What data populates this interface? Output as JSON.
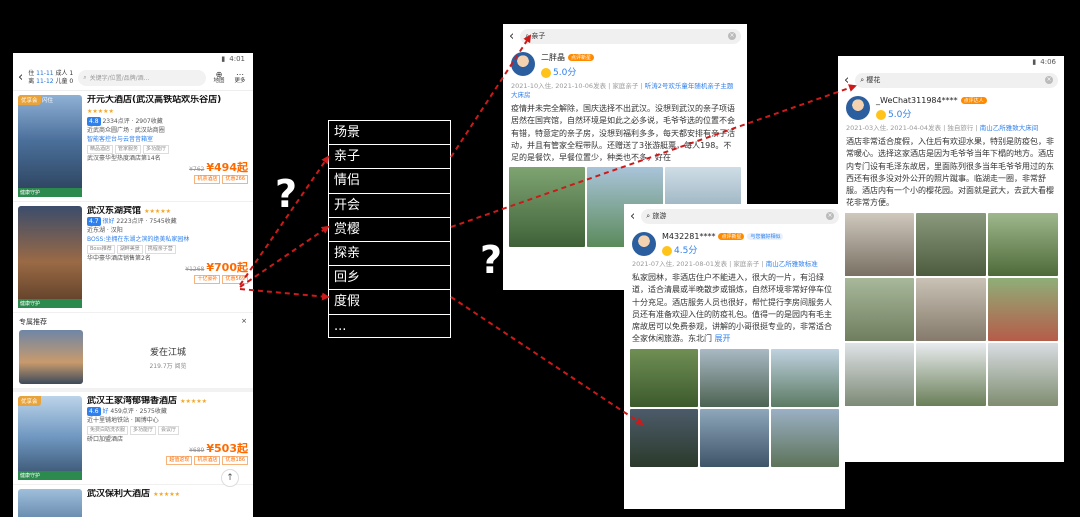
{
  "colors": {
    "arrow": "#cc1a1a",
    "accent": "#2f80ed",
    "price": "#ff6a00"
  },
  "hotel_list": {
    "status": "4:01",
    "header": {
      "in_label": "住",
      "in_date": "11-11",
      "out_label": "离",
      "out_date": "11-12",
      "adults": "成人 1",
      "children": "儿童 0",
      "search_placeholder": "关键字/位置/品牌/酒...",
      "map_label": "地图",
      "more_label": "更多"
    },
    "hotels": [
      {
        "tag": "优享会",
        "tag2": "闪住",
        "name": "开元大酒店(武汉高铁站欢乐谷店)",
        "stars": "★★★★★",
        "score": "4.8",
        "reviews": "2334点评 · 2907收藏",
        "location": "近武商众圆广场 · 武汉站商圈",
        "features": "智能客控台与云音音箱室",
        "tags": [
          "精品酒店",
          "管家服务",
          "多功能厅"
        ],
        "note": "武汉豪华型热度酒店第14名",
        "old_price": "¥762",
        "price": "¥494起",
        "promo_tags": [
          "机票酒店",
          "优惠266"
        ],
        "foot": "健康守护"
      },
      {
        "tag": "",
        "tag2": "",
        "name": "武汉东湖宾馆",
        "stars": "★★★★★",
        "score": "4.7",
        "score_word": "很好",
        "reviews": "2223点评 · 7545收藏",
        "location": "近东湖 · 汉阳",
        "boss": "BOSS:坐拥在东湖之滨的绝美私家园林",
        "tags": [
          "Boss推荐",
          "湖畔美景",
          "携程亲子营"
        ],
        "note": "华中豪华酒店销售第2名",
        "old_price": "¥1268",
        "price": "¥700起",
        "promo_tags": [
          "十亿豪补",
          "优惠569"
        ],
        "foot": "健康守护"
      },
      {
        "tag": "优享会",
        "tag2": "",
        "name": "武汉王家湾郁锦香酒店",
        "stars": "★★★★★",
        "score": "4.6",
        "score_word": "好",
        "reviews": "459点评 · 2575收藏",
        "location": "近十里铺地铁站 · 国博中心",
        "boss": "免费白助洗衣服",
        "tags": [
          "多功能厅",
          "会议厅"
        ],
        "note": "硚口加盟酒店",
        "old_price": "¥689",
        "price": "¥503起",
        "promo_tags": [
          "超值返现",
          "机票酒店",
          "优惠186"
        ],
        "foot": "健康守护"
      },
      {
        "tag": "",
        "tag2": "",
        "name": "武汉保利大酒店",
        "stars": "★★★★★",
        "score": "",
        "reviews": "",
        "location": "",
        "tags": [],
        "note": "",
        "old_price": "",
        "price": "",
        "promo_tags": [],
        "foot": ""
      }
    ],
    "promo": {
      "title": "专属推荐",
      "close": "×",
      "text": "爱在江城",
      "sub": "219.7万 阅览"
    }
  },
  "menu": [
    "场景",
    "亲子",
    "情侣",
    "开会",
    "赏樱",
    "探亲",
    "回乡",
    "度假",
    "..."
  ],
  "question_marks": [
    "?",
    "?"
  ],
  "review_qinzi": {
    "search": "亲子",
    "user": "二胖晶",
    "badge": "点评新星",
    "score": "5.0分",
    "meta1": "2021-10入住, 2021-10-06发表",
    "meta_type": "家庭亲子",
    "room": "听涛2号欢乐童年随机亲子主题大床房",
    "text": "疫情并未完全解除，国庆选择不出武汉。没想到武汉的亲子项语居然在国宾馆，自然环境是如此之必多说，毛爷爷选的位置不会有错，特意定的亲子房，没想到福利多多，每天都安排有亲子活动，并且有管家全程带队。还赠送了3张游艇票，每人198。不足的是餐饮，早餐位置少，种类也不多，好在"
  },
  "review_lvyou": {
    "search": "旅游",
    "user": "M432281****",
    "badge": "点评新星",
    "badge2": "与您偏好相似",
    "score": "4.5分",
    "meta1": "2021-07入住, 2021-08-01发表",
    "meta_type": "家庭亲子",
    "room": "南山乙所雅致标准",
    "text": "私家园林，非酒店住户不能进入，很大的一片，有沿绿道，适合清晨或半晚散步或锻炼，自然环境非常好停车位十分充足。酒店服务人员也很好，帮忙提行李房间服务人员还有准备欢迎入住的防疫礼包。值得一的是园内有毛主席故居可以免费参观，讲解的小哥很挺专业的，非常适合全家休闲旅游。东北门",
    "more": "展开"
  },
  "review_yinghua": {
    "status": "4:06",
    "search": "樱花",
    "user": "_WeChat311984****",
    "badge": "点评达人",
    "score": "5.0分",
    "meta1": "2021-03入住, 2021-04-04发表",
    "meta_type": "独自旅行",
    "room": "南山乙所雅致大床间",
    "text": "酒店非常适合度假，入住后有欢迎水果，特别是防疫包，非常暖心。选择这家酒店是因为毛爷爷当年下榻的地方。酒店内专门设有毛泽东故居，里面陈列很多当年毛爷爷用过的东西还有很多没对外公开的照片蹴事。临湖走一圈，非常舒服。酒店内有一个小的樱花园。对面就是武大，去武大看樱花非常方便。"
  }
}
